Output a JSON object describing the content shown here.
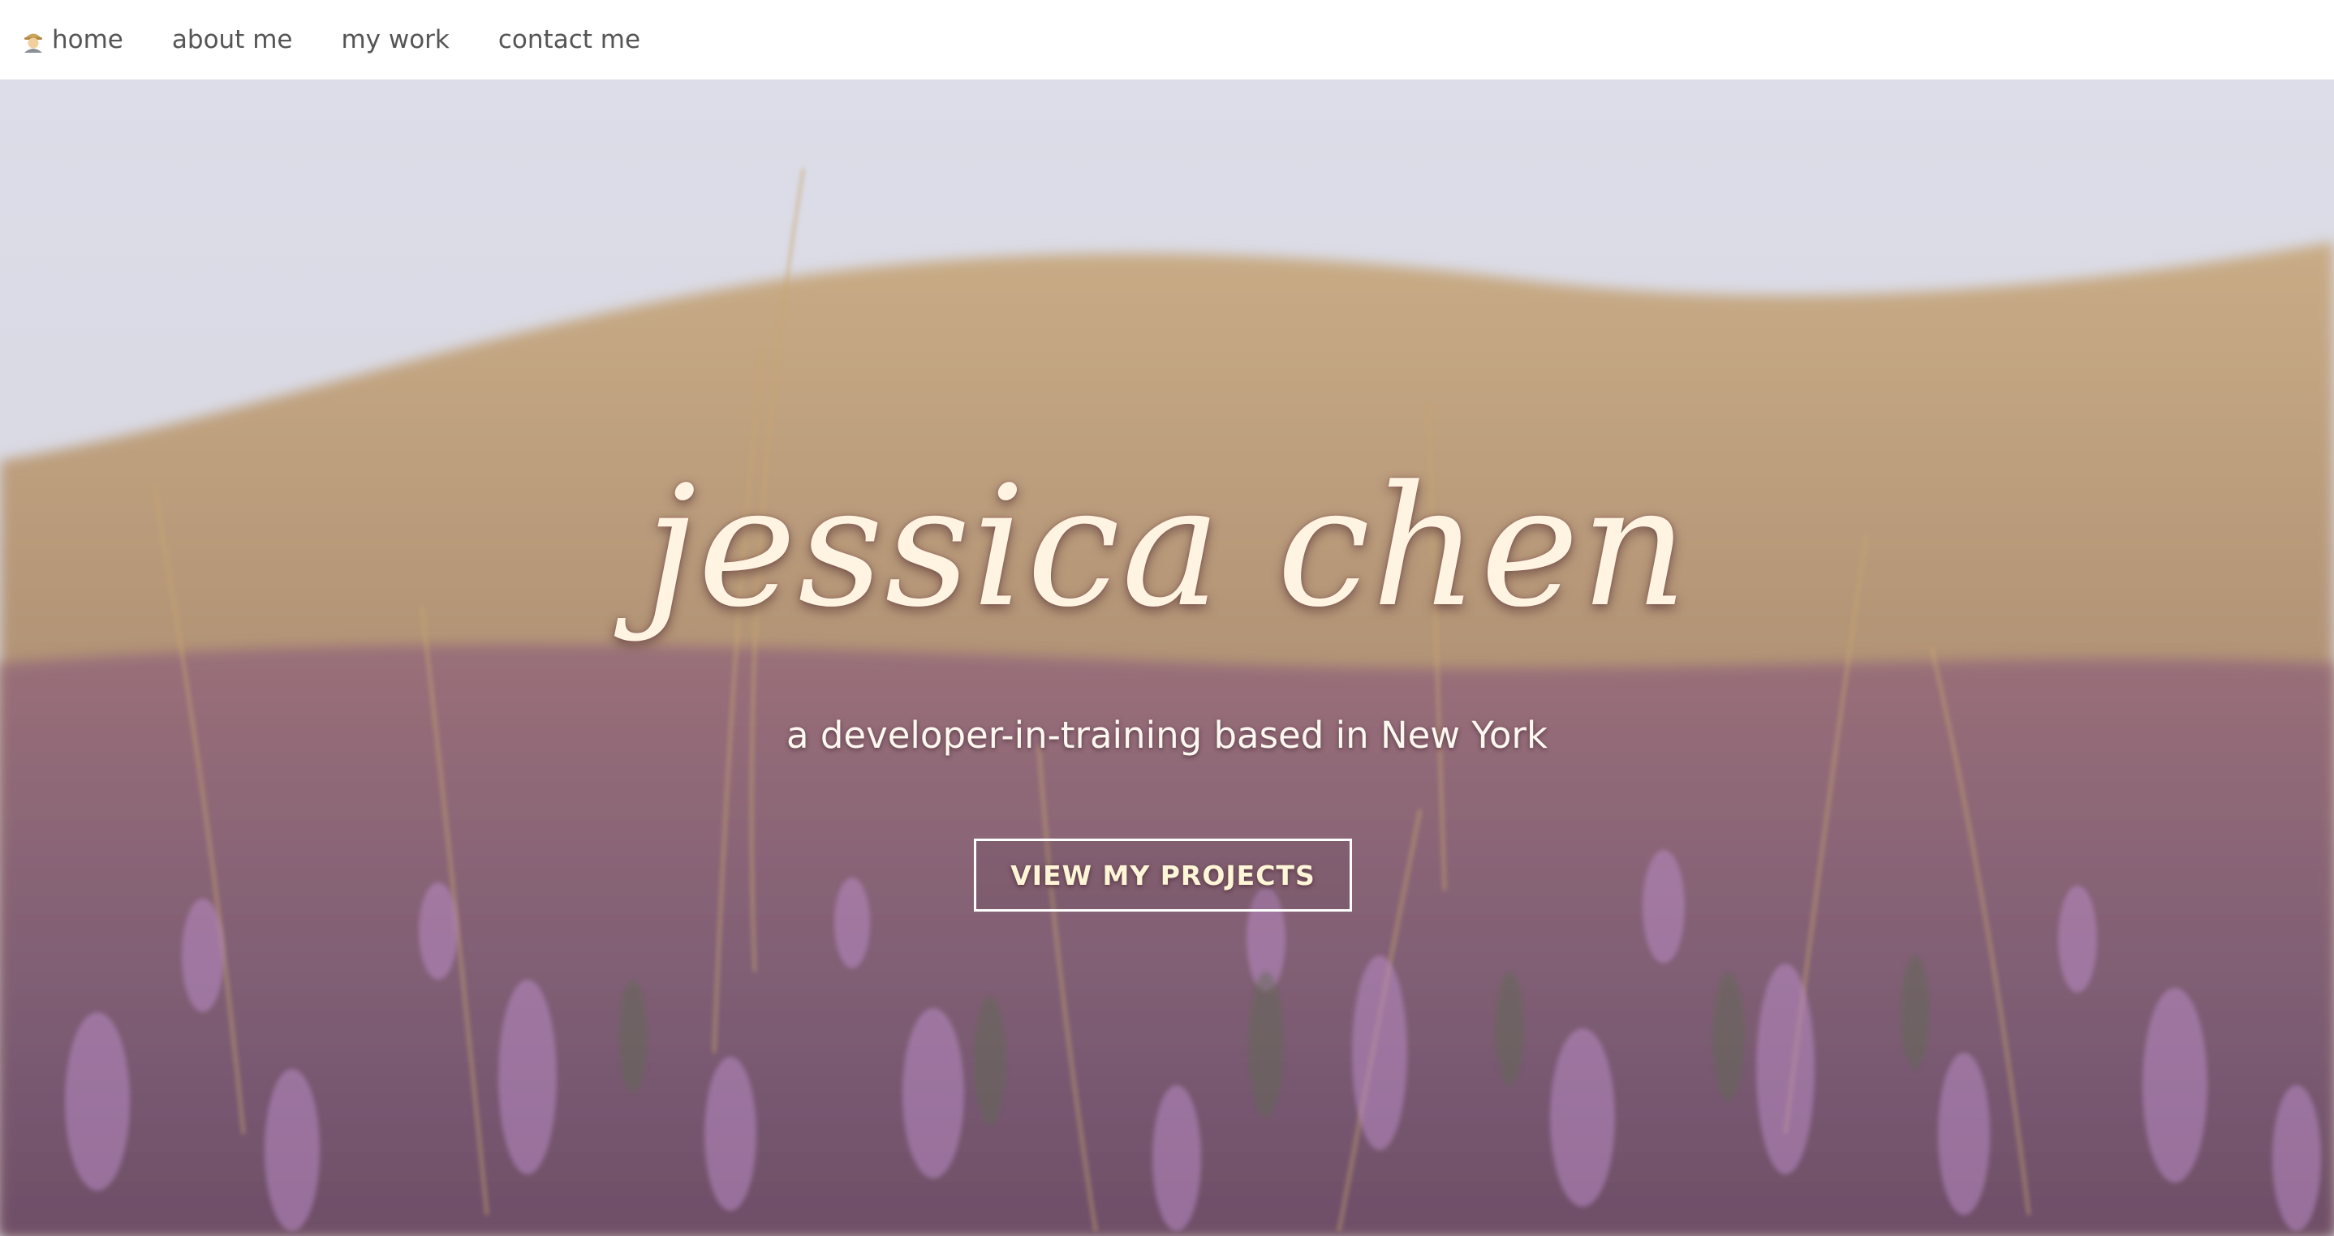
{
  "nav": {
    "items": [
      {
        "label": "home",
        "icon": "person-emoji-icon"
      },
      {
        "label": "about me"
      },
      {
        "label": "my work"
      },
      {
        "label": "contact me"
      }
    ]
  },
  "hero": {
    "title": "jessica chen",
    "subtitle": "a developer-in-training based in New York",
    "button_label": "VIEW MY PROJECTS",
    "background": "flower-meadow-photo"
  },
  "colors": {
    "nav_text": "#555555",
    "title_text": "#fff4e2",
    "button_border": "#ffffff"
  }
}
